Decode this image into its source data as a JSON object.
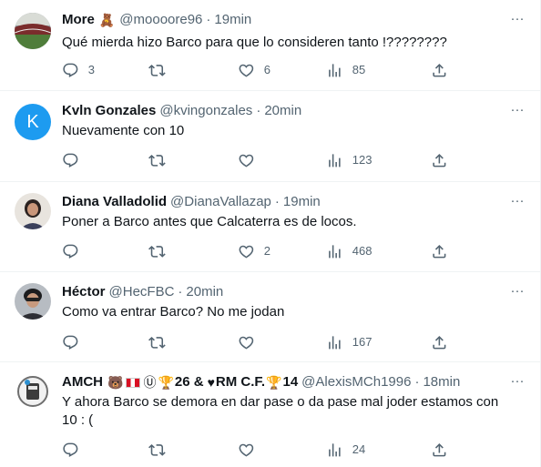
{
  "tweets": [
    {
      "name": "More",
      "name_emoji": "🧸",
      "handle": "@moooore96",
      "time": "19min",
      "text": "Qué mierda hizo Barco para que lo consideren tanto !????????",
      "replies": "3",
      "retweets": "",
      "likes": "6",
      "views": "85",
      "avatar_icon": "stadium-photo-avatar"
    },
    {
      "name": "Kvln Gonzales",
      "handle": "@kvingonzales",
      "time": "20min",
      "text": "Nuevamente con 10",
      "replies": "",
      "retweets": "",
      "likes": "",
      "views": "123",
      "avatar_letter": "K",
      "avatar_color": "#1d9bf0"
    },
    {
      "name": "Diana Valladolid",
      "handle": "@DianaVallazap",
      "time": "19min",
      "text": "Poner a Barco antes que Calcaterra es de locos.",
      "replies": "",
      "retweets": "",
      "likes": "2",
      "views": "468",
      "avatar_icon": "woman-photo-avatar"
    },
    {
      "name": "Héctor",
      "handle": "@HecFBC",
      "time": "20min",
      "text": "Como va entrar Barco? No me jodan",
      "replies": "",
      "retweets": "",
      "likes": "",
      "views": "167",
      "avatar_icon": "man-photo-avatar"
    },
    {
      "name": "AMCH",
      "name_parts": [
        "26 &",
        "RM C.F.",
        "14"
      ],
      "handle": "@AlexisMCh1996",
      "time": "18min",
      "text": "Y ahora Barco se demora en dar pase o da pase mal joder estamos con 10 : (",
      "replies": "",
      "retweets": "",
      "likes": "",
      "views": "24",
      "avatar_icon": "club-crest-avatar"
    }
  ],
  "ui": {
    "dot": "·",
    "more": "···"
  },
  "colors": {
    "text": "#0f1419",
    "muted": "#536471",
    "accent": "#1d9bf0",
    "divider": "#eff3f4"
  }
}
